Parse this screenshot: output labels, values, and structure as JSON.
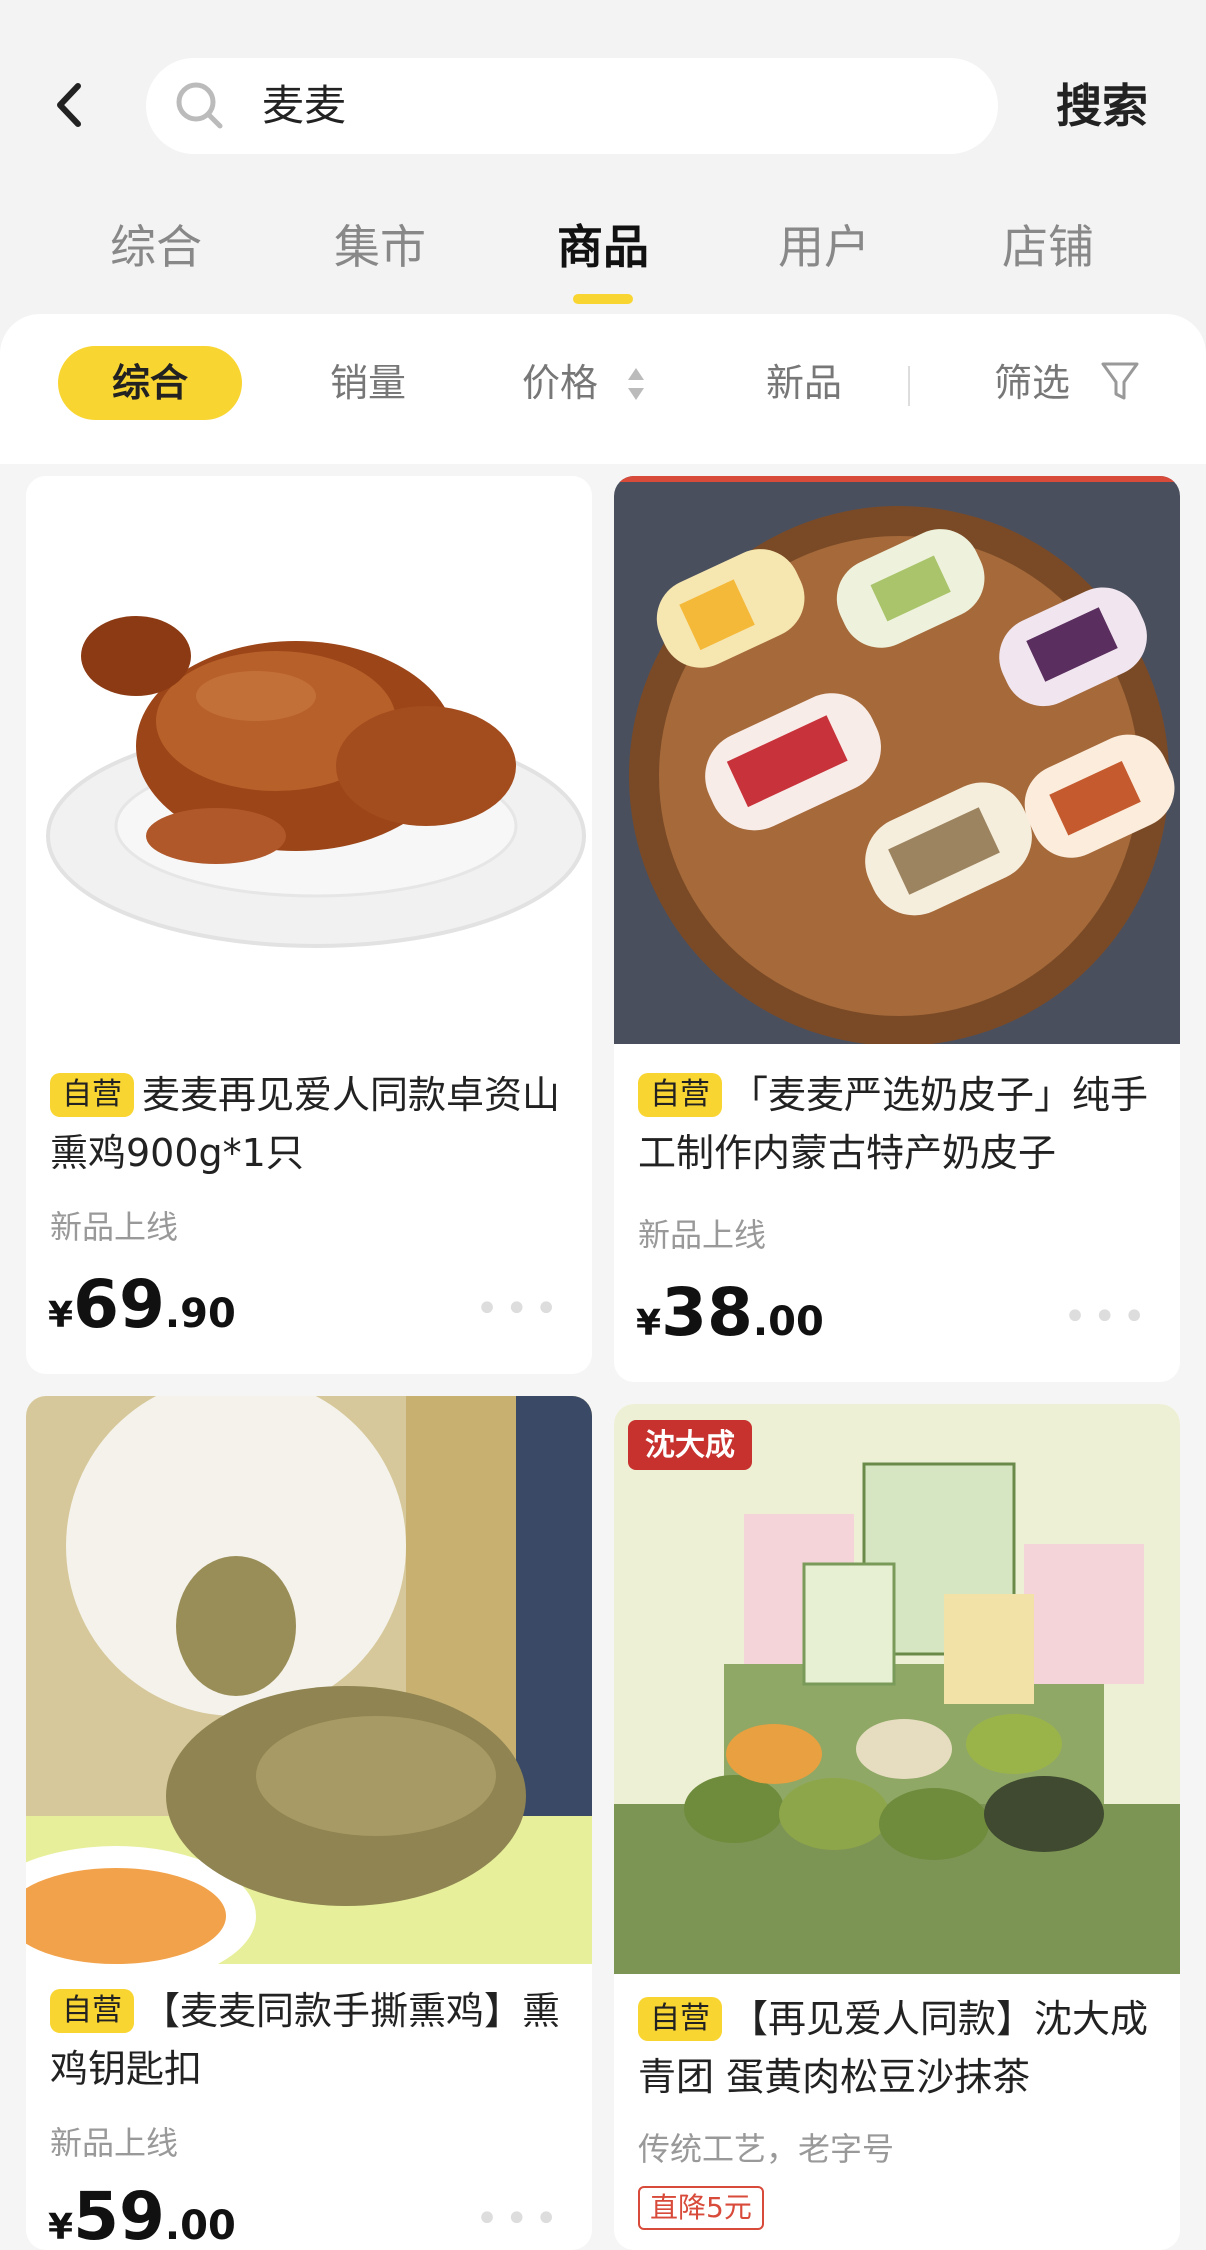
{
  "header": {
    "search_query": "麦麦",
    "search_button": "搜索"
  },
  "tabs": [
    {
      "label": "综合"
    },
    {
      "label": "集市"
    },
    {
      "label": "商品"
    },
    {
      "label": "用户"
    },
    {
      "label": "店铺"
    }
  ],
  "active_tab": "商品",
  "sort_bar": {
    "comprehensive": "综合",
    "sales": "销量",
    "price": "价格",
    "new": "新品",
    "filter": "筛选"
  },
  "colors": {
    "accent": "#f9d531",
    "promo": "#d84a3a"
  },
  "products": [
    {
      "badge": "自营",
      "title": "麦麦再见爱人同款卓资山熏鸡900g*1只",
      "subtitle": "新品上线",
      "currency": "¥",
      "price_int": "69",
      "price_dec": ".90",
      "image": "smoked-chicken"
    },
    {
      "badge": "自营",
      "title": "「麦麦严选奶皮子」纯手工制作内蒙古特产奶皮子",
      "subtitle": "新品上线",
      "currency": "¥",
      "price_int": "38",
      "price_dec": ".00",
      "image": "milk-skin-rolls"
    },
    {
      "badge": "自营",
      "title": "【麦麦同款手撕熏鸡】熏鸡钥匙扣",
      "subtitle": "新品上线",
      "currency": "¥",
      "price_int": "59",
      "price_dec": ".00",
      "image": "chicken-keychain"
    },
    {
      "badge": "自营",
      "title": "【再见爱人同款】沈大成青团 蛋黄肉松豆沙抹茶",
      "subtitle": "传统工艺，老字号",
      "promo": "直降5元",
      "image": "qingtuan-gift-box",
      "brand_text": "沈大成"
    }
  ]
}
